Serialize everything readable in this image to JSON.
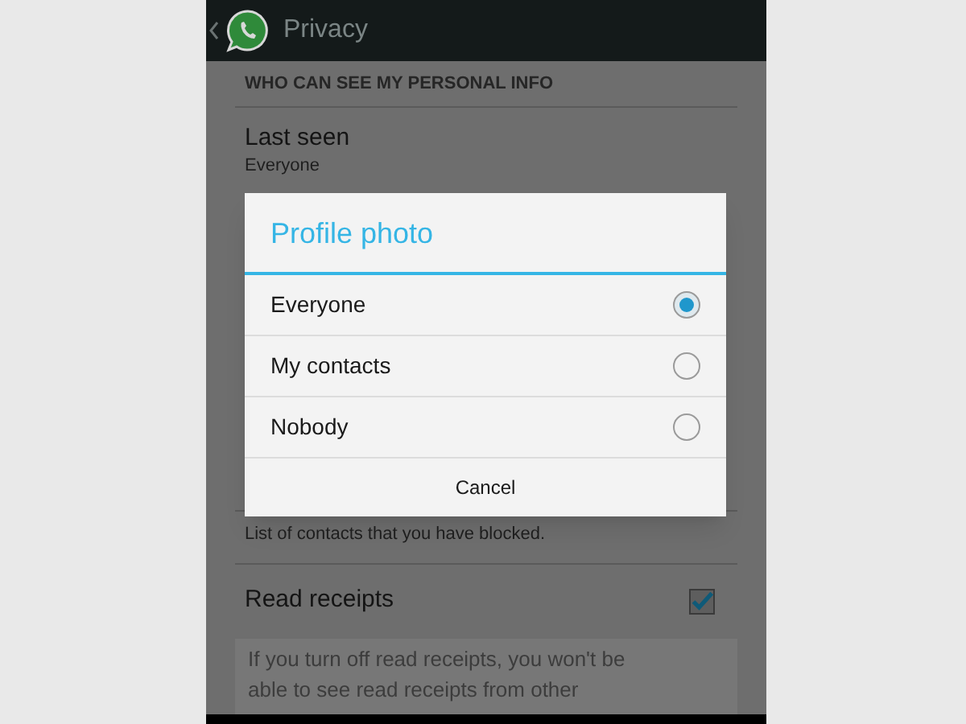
{
  "top_bar": {
    "title": "Privacy"
  },
  "section_header": "WHO CAN SEE MY PERSONAL INFO",
  "last_seen": {
    "label": "Last seen",
    "value": "Everyone"
  },
  "blocked_description": "List of contacts that you have blocked.",
  "read_receipts": {
    "label": "Read receipts",
    "checked": true,
    "info": "If you turn off read receipts, you won't be able to see read receipts from other"
  },
  "dialog": {
    "title": "Profile photo",
    "options": [
      {
        "label": "Everyone",
        "selected": true
      },
      {
        "label": "My contacts",
        "selected": false
      },
      {
        "label": "Nobody",
        "selected": false
      }
    ],
    "cancel": "Cancel"
  }
}
